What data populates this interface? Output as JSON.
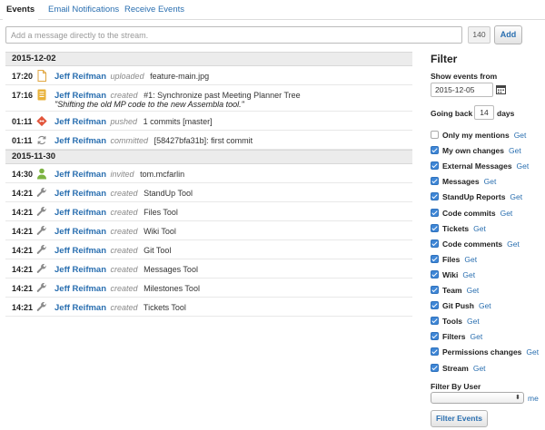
{
  "tabs": [
    {
      "label": "Events",
      "active": true
    },
    {
      "label": "Email Notifications",
      "active": false
    },
    {
      "label": "Receive Events",
      "active": false
    }
  ],
  "message": {
    "placeholder": "Add a message directly to the stream.",
    "counter": "140",
    "add_label": "Add"
  },
  "events": {
    "groups": [
      {
        "date": "2015-12-02",
        "items": [
          {
            "time": "17:20",
            "icon": "file-icon",
            "user": "Jeff Reifman",
            "verb": "uploaded",
            "object": "feature-main.jpg",
            "detail": ""
          },
          {
            "time": "17:16",
            "icon": "ticket-icon",
            "user": "Jeff Reifman",
            "verb": "created",
            "object": "#1: Synchronize past Meeting Planner Tree",
            "detail": "\"Shifting the old MP code to the new Assembla tool.\""
          },
          {
            "time": "01:11",
            "icon": "git-push-icon",
            "user": "Jeff Reifman",
            "verb": "pushed",
            "object": "1 commits [master]",
            "detail": ""
          },
          {
            "time": "01:11",
            "icon": "sync-icon",
            "user": "Jeff Reifman",
            "verb": "committed",
            "object": "[58427bfa31b]: first commit",
            "detail": ""
          }
        ]
      },
      {
        "date": "2015-11-30",
        "items": [
          {
            "time": "14:30",
            "icon": "user-icon",
            "user": "Jeff Reifman",
            "verb": "invited",
            "object": "tom.mcfarlin",
            "detail": ""
          },
          {
            "time": "14:21",
            "icon": "wrench-icon",
            "user": "Jeff Reifman",
            "verb": "created",
            "object": "StandUp Tool",
            "detail": ""
          },
          {
            "time": "14:21",
            "icon": "wrench-icon",
            "user": "Jeff Reifman",
            "verb": "created",
            "object": "Files Tool",
            "detail": ""
          },
          {
            "time": "14:21",
            "icon": "wrench-icon",
            "user": "Jeff Reifman",
            "verb": "created",
            "object": "Wiki Tool",
            "detail": ""
          },
          {
            "time": "14:21",
            "icon": "wrench-icon",
            "user": "Jeff Reifman",
            "verb": "created",
            "object": "Git Tool",
            "detail": ""
          },
          {
            "time": "14:21",
            "icon": "wrench-icon",
            "user": "Jeff Reifman",
            "verb": "created",
            "object": "Messages Tool",
            "detail": ""
          },
          {
            "time": "14:21",
            "icon": "wrench-icon",
            "user": "Jeff Reifman",
            "verb": "created",
            "object": "Milestones Tool",
            "detail": ""
          },
          {
            "time": "14:21",
            "icon": "wrench-icon",
            "user": "Jeff Reifman",
            "verb": "created",
            "object": "Tickets Tool",
            "detail": ""
          }
        ]
      }
    ]
  },
  "filter": {
    "title": "Filter",
    "show_from_label": "Show events from",
    "date_value": "2015-12-05",
    "going_back_label": "Going back",
    "days_value": "14",
    "days_label": "days",
    "get_label": "Get",
    "checkboxes": [
      {
        "label": "Only my mentions",
        "checked": false
      },
      {
        "label": "My own changes",
        "checked": true
      },
      {
        "label": "External Messages",
        "checked": true
      },
      {
        "label": "Messages",
        "checked": true
      },
      {
        "label": "StandUp Reports",
        "checked": true
      },
      {
        "label": "Code commits",
        "checked": true
      },
      {
        "label": "Tickets",
        "checked": true
      },
      {
        "label": "Code comments",
        "checked": true
      },
      {
        "label": "Files",
        "checked": true
      },
      {
        "label": "Wiki",
        "checked": true
      },
      {
        "label": "Team",
        "checked": true
      },
      {
        "label": "Git Push",
        "checked": true
      },
      {
        "label": "Tools",
        "checked": true
      },
      {
        "label": "Filters",
        "checked": true
      },
      {
        "label": "Permissions changes",
        "checked": true
      },
      {
        "label": "Stream",
        "checked": true
      }
    ],
    "by_user_label": "Filter By User",
    "selected_user": "",
    "me_label": "me",
    "button_label": "Filter Events"
  },
  "colors": {
    "link": "#2a6fb0",
    "checkbox": "#3e86d6",
    "date_header_bg": "#ececec",
    "ticket_icon": "#e8b23a",
    "git_icon": "#e2553b",
    "user_icon": "#7cb342"
  }
}
